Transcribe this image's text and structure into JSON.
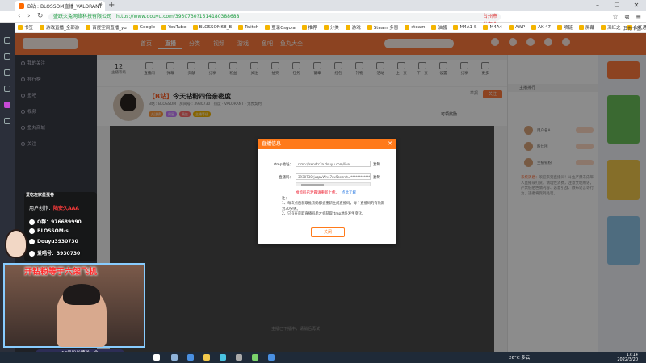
{
  "browser": {
    "tab_title": "B站 : BLOSSOM直播_VALORANT",
    "new_tab": "+",
    "url_secure_label": "盛跃火兔网络科技有限公司",
    "url": "https://www.douyu.com/3930730?1514180388688",
    "url_hint": "台州市发布全域静态管理",
    "bookmarks": [
      "书签",
      "游戏直播_全部游",
      "百度空间直播_yu",
      "Google",
      "YouTube",
      "BLOSSOM68_B",
      "Twitch",
      "登录Csgola",
      "推荐",
      "分类",
      "游戏",
      "Steam 多窗",
      "steam",
      "油酱",
      "M4A1-S",
      "M4A4",
      "AWP",
      "AK-47",
      "项链",
      "屏幕",
      "深红之",
      "久延通系统"
    ],
    "bookmarks_right": "其他书签"
  },
  "douyu": {
    "nav": [
      "首页",
      "直播",
      "分类",
      "视频",
      "游戏",
      "鱼吧",
      "鱼丸大全"
    ],
    "toolbar_count": "12",
    "toolbar_count_label": "主播等级",
    "toolbar_items": [
      "直播间",
      "弹幕",
      "贡献",
      "分享",
      "粉丝",
      "关注",
      "抽奖",
      "任务",
      "徽章",
      "红包",
      "礼物",
      "活动",
      "上一页",
      "下一页",
      "设置",
      "分享",
      "更多"
    ],
    "room_tag": "【B站】",
    "room_title": "今天钻粉四倍亲密度",
    "room_meta": "B站 : BLOSSOM  ·  房间号 : 3930730  ·  热度  ·  VALORANT  ·  无畏契约",
    "badges": [
      "关注榜",
      "周星",
      "贵族",
      "主播等级"
    ],
    "follow_label": "关注",
    "report_label": "举报",
    "rank_label": "可领奖励",
    "video_caption": "主播已下播中，请稍后再试"
  },
  "sidebar": {
    "items": [
      "我的关注",
      "排行榜",
      "鱼吧",
      "视频",
      "鱼丸商城",
      "关注"
    ]
  },
  "chat": {
    "header": "主播排行",
    "users": [
      "用户名A",
      "粉丝团",
      "主播铁粉"
    ],
    "text_hl": "系统消息：",
    "text": "欢迎来到直播间！斗鱼严禁未成年人直播或打赏。请理性消费，注意文明用语，严禁低俗色情内容、恶意引战、散布谣言等行为，违者将受到处罚。"
  },
  "modal": {
    "title": "直播信息",
    "rtmp_label": "rtmp地址：",
    "rtmp_value": "rtmp://sendtc3a.douyu.com/live",
    "code_label": "直播码：",
    "code_value": "3930730rjuqavWn47uv5secret=**************",
    "copy_label": "复制",
    "warning": "推流码已泄露请重新上传。",
    "warning_link": "点此了解",
    "notes": [
      "注：",
      "1、每次点击获取推流码都会重新生成直播码，每个直播码的有效期为30分钟。",
      "2、只有在获取直播码后才会获取rtmp地址发生变化。"
    ],
    "ok_label": "关闭"
  },
  "overlay": {
    "banner": "爱吃左家星蛋卷",
    "author_label": "用户创作：",
    "author_name": "陆安久AAA",
    "lines": [
      "Q群：976689990",
      "BLOSSOM-s",
      "Douyu3930730",
      "爱唱号：3930730"
    ],
    "cam_title": "开钻粉等于六架飞机",
    "cam_caption": "12级粉丝牌送一个"
  },
  "taskbar": {
    "weather": "26°C 多云",
    "time": "17:14",
    "date": "2022/3/20"
  },
  "colors": {
    "brand": "#ff7a3d",
    "modal_header": "#ff7a1a",
    "warning": "#ee2233",
    "link": "#2a7ae2"
  }
}
